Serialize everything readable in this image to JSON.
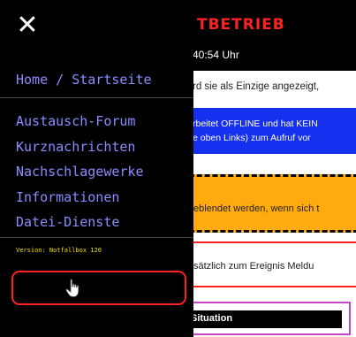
{
  "page": {
    "title": "TBETRIEB",
    "time": "40:54 Uhr",
    "line1": "rd sie als Einzige angezeigt,",
    "blue_line1": "rbeitet OFFLINE und hat KEIN",
    "blue_line2": "e oben Links) zum Aufruf vor",
    "orange_text": "eblendet werden, wenn sich t",
    "red_text": "sätzlich zum Ereignis Meldu",
    "situation": "Situation"
  },
  "menu": {
    "close_icon": "close-icon",
    "close_glyph": "✕",
    "home": "Home / Startseite",
    "items": [
      {
        "label": "Austausch-Forum"
      },
      {
        "label": "Kurznachrichten"
      },
      {
        "label": "Nachschlagewerke"
      },
      {
        "label": "Informationen"
      },
      {
        "label": "Datei-Dienste"
      }
    ],
    "version": "Version: Notfallbox 120",
    "action_icon": "hand-pointer-icon"
  },
  "colors": {
    "menu_bg": "#000000",
    "link": "#8a8cff",
    "title": "#ff2222",
    "version": "#f0e000",
    "button_border": "#ff2222",
    "info_box": "#1530ee",
    "warning_box": "#ffab10"
  }
}
